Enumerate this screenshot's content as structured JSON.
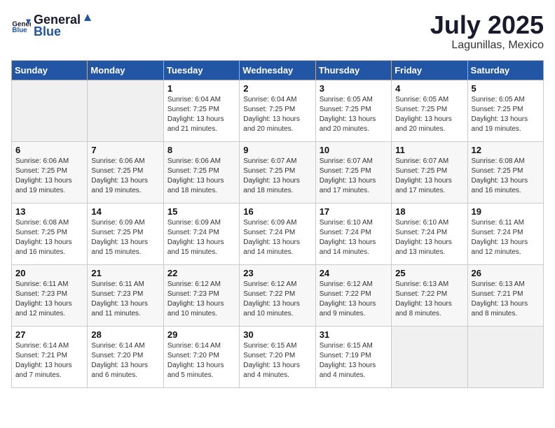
{
  "header": {
    "logo_general": "General",
    "logo_blue": "Blue",
    "month": "July 2025",
    "location": "Lagunillas, Mexico"
  },
  "weekdays": [
    "Sunday",
    "Monday",
    "Tuesday",
    "Wednesday",
    "Thursday",
    "Friday",
    "Saturday"
  ],
  "weeks": [
    [
      {
        "day": "",
        "sunrise": "",
        "sunset": "",
        "daylight": "",
        "empty": true
      },
      {
        "day": "",
        "sunrise": "",
        "sunset": "",
        "daylight": "",
        "empty": true
      },
      {
        "day": "1",
        "sunrise": "Sunrise: 6:04 AM",
        "sunset": "Sunset: 7:25 PM",
        "daylight": "Daylight: 13 hours and 21 minutes.",
        "empty": false
      },
      {
        "day": "2",
        "sunrise": "Sunrise: 6:04 AM",
        "sunset": "Sunset: 7:25 PM",
        "daylight": "Daylight: 13 hours and 20 minutes.",
        "empty": false
      },
      {
        "day": "3",
        "sunrise": "Sunrise: 6:05 AM",
        "sunset": "Sunset: 7:25 PM",
        "daylight": "Daylight: 13 hours and 20 minutes.",
        "empty": false
      },
      {
        "day": "4",
        "sunrise": "Sunrise: 6:05 AM",
        "sunset": "Sunset: 7:25 PM",
        "daylight": "Daylight: 13 hours and 20 minutes.",
        "empty": false
      },
      {
        "day": "5",
        "sunrise": "Sunrise: 6:05 AM",
        "sunset": "Sunset: 7:25 PM",
        "daylight": "Daylight: 13 hours and 19 minutes.",
        "empty": false
      }
    ],
    [
      {
        "day": "6",
        "sunrise": "Sunrise: 6:06 AM",
        "sunset": "Sunset: 7:25 PM",
        "daylight": "Daylight: 13 hours and 19 minutes.",
        "empty": false
      },
      {
        "day": "7",
        "sunrise": "Sunrise: 6:06 AM",
        "sunset": "Sunset: 7:25 PM",
        "daylight": "Daylight: 13 hours and 19 minutes.",
        "empty": false
      },
      {
        "day": "8",
        "sunrise": "Sunrise: 6:06 AM",
        "sunset": "Sunset: 7:25 PM",
        "daylight": "Daylight: 13 hours and 18 minutes.",
        "empty": false
      },
      {
        "day": "9",
        "sunrise": "Sunrise: 6:07 AM",
        "sunset": "Sunset: 7:25 PM",
        "daylight": "Daylight: 13 hours and 18 minutes.",
        "empty": false
      },
      {
        "day": "10",
        "sunrise": "Sunrise: 6:07 AM",
        "sunset": "Sunset: 7:25 PM",
        "daylight": "Daylight: 13 hours and 17 minutes.",
        "empty": false
      },
      {
        "day": "11",
        "sunrise": "Sunrise: 6:07 AM",
        "sunset": "Sunset: 7:25 PM",
        "daylight": "Daylight: 13 hours and 17 minutes.",
        "empty": false
      },
      {
        "day": "12",
        "sunrise": "Sunrise: 6:08 AM",
        "sunset": "Sunset: 7:25 PM",
        "daylight": "Daylight: 13 hours and 16 minutes.",
        "empty": false
      }
    ],
    [
      {
        "day": "13",
        "sunrise": "Sunrise: 6:08 AM",
        "sunset": "Sunset: 7:25 PM",
        "daylight": "Daylight: 13 hours and 16 minutes.",
        "empty": false
      },
      {
        "day": "14",
        "sunrise": "Sunrise: 6:09 AM",
        "sunset": "Sunset: 7:25 PM",
        "daylight": "Daylight: 13 hours and 15 minutes.",
        "empty": false
      },
      {
        "day": "15",
        "sunrise": "Sunrise: 6:09 AM",
        "sunset": "Sunset: 7:24 PM",
        "daylight": "Daylight: 13 hours and 15 minutes.",
        "empty": false
      },
      {
        "day": "16",
        "sunrise": "Sunrise: 6:09 AM",
        "sunset": "Sunset: 7:24 PM",
        "daylight": "Daylight: 13 hours and 14 minutes.",
        "empty": false
      },
      {
        "day": "17",
        "sunrise": "Sunrise: 6:10 AM",
        "sunset": "Sunset: 7:24 PM",
        "daylight": "Daylight: 13 hours and 14 minutes.",
        "empty": false
      },
      {
        "day": "18",
        "sunrise": "Sunrise: 6:10 AM",
        "sunset": "Sunset: 7:24 PM",
        "daylight": "Daylight: 13 hours and 13 minutes.",
        "empty": false
      },
      {
        "day": "19",
        "sunrise": "Sunrise: 6:11 AM",
        "sunset": "Sunset: 7:24 PM",
        "daylight": "Daylight: 13 hours and 12 minutes.",
        "empty": false
      }
    ],
    [
      {
        "day": "20",
        "sunrise": "Sunrise: 6:11 AM",
        "sunset": "Sunset: 7:23 PM",
        "daylight": "Daylight: 13 hours and 12 minutes.",
        "empty": false
      },
      {
        "day": "21",
        "sunrise": "Sunrise: 6:11 AM",
        "sunset": "Sunset: 7:23 PM",
        "daylight": "Daylight: 13 hours and 11 minutes.",
        "empty": false
      },
      {
        "day": "22",
        "sunrise": "Sunrise: 6:12 AM",
        "sunset": "Sunset: 7:23 PM",
        "daylight": "Daylight: 13 hours and 10 minutes.",
        "empty": false
      },
      {
        "day": "23",
        "sunrise": "Sunrise: 6:12 AM",
        "sunset": "Sunset: 7:22 PM",
        "daylight": "Daylight: 13 hours and 10 minutes.",
        "empty": false
      },
      {
        "day": "24",
        "sunrise": "Sunrise: 6:12 AM",
        "sunset": "Sunset: 7:22 PM",
        "daylight": "Daylight: 13 hours and 9 minutes.",
        "empty": false
      },
      {
        "day": "25",
        "sunrise": "Sunrise: 6:13 AM",
        "sunset": "Sunset: 7:22 PM",
        "daylight": "Daylight: 13 hours and 8 minutes.",
        "empty": false
      },
      {
        "day": "26",
        "sunrise": "Sunrise: 6:13 AM",
        "sunset": "Sunset: 7:21 PM",
        "daylight": "Daylight: 13 hours and 8 minutes.",
        "empty": false
      }
    ],
    [
      {
        "day": "27",
        "sunrise": "Sunrise: 6:14 AM",
        "sunset": "Sunset: 7:21 PM",
        "daylight": "Daylight: 13 hours and 7 minutes.",
        "empty": false
      },
      {
        "day": "28",
        "sunrise": "Sunrise: 6:14 AM",
        "sunset": "Sunset: 7:20 PM",
        "daylight": "Daylight: 13 hours and 6 minutes.",
        "empty": false
      },
      {
        "day": "29",
        "sunrise": "Sunrise: 6:14 AM",
        "sunset": "Sunset: 7:20 PM",
        "daylight": "Daylight: 13 hours and 5 minutes.",
        "empty": false
      },
      {
        "day": "30",
        "sunrise": "Sunrise: 6:15 AM",
        "sunset": "Sunset: 7:20 PM",
        "daylight": "Daylight: 13 hours and 4 minutes.",
        "empty": false
      },
      {
        "day": "31",
        "sunrise": "Sunrise: 6:15 AM",
        "sunset": "Sunset: 7:19 PM",
        "daylight": "Daylight: 13 hours and 4 minutes.",
        "empty": false
      },
      {
        "day": "",
        "sunrise": "",
        "sunset": "",
        "daylight": "",
        "empty": true
      },
      {
        "day": "",
        "sunrise": "",
        "sunset": "",
        "daylight": "",
        "empty": true
      }
    ]
  ]
}
